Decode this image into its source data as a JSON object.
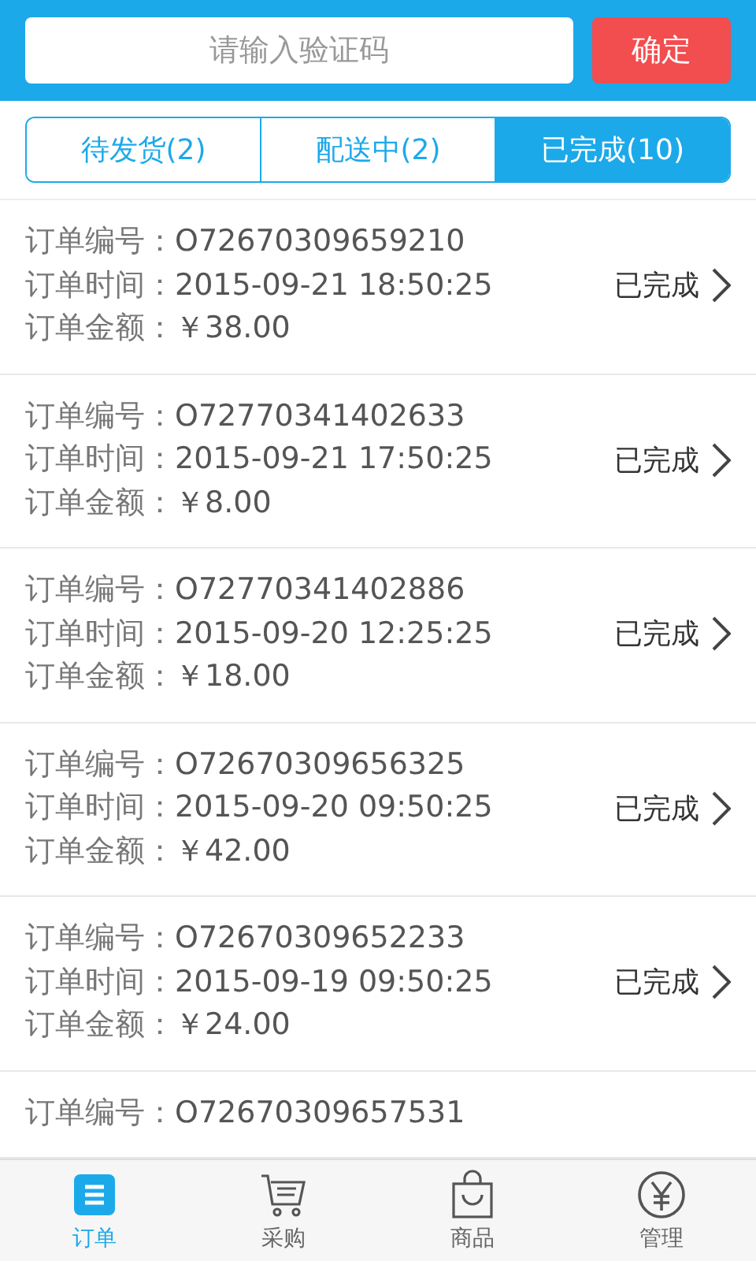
{
  "search": {
    "placeholder": "请输入验证码",
    "button": "确定"
  },
  "tabs": [
    {
      "label": "待发货(2)",
      "selected": false
    },
    {
      "label": "配送中(2)",
      "selected": false
    },
    {
      "label": "已完成(10)",
      "selected": true
    }
  ],
  "orders": [
    {
      "lines": [
        {
          "label": "订单编号：",
          "value": "O72670309659210"
        },
        {
          "label": "订单时间：",
          "value": "2015-09-21 18:50:25"
        },
        {
          "label": "订单金额：",
          "value": "￥38.00"
        }
      ],
      "status": "已完成"
    },
    {
      "lines": [
        {
          "label": "订单编号：",
          "value": "O72770341402633"
        },
        {
          "label": "订单时间：",
          "value": "2015-09-21 17:50:25"
        },
        {
          "label": "订单金额：",
          "value": "￥8.00"
        }
      ],
      "status": "已完成"
    },
    {
      "lines": [
        {
          "label": "订单编号：",
          "value": "O72770341402886"
        },
        {
          "label": "订单时间：",
          "value": "2015-09-20 12:25:25"
        },
        {
          "label": "订单金额：",
          "value": "￥18.00"
        }
      ],
      "status": "已完成"
    },
    {
      "lines": [
        {
          "label": "订单编号：",
          "value": "O72670309656325"
        },
        {
          "label": "订单时间：",
          "value": "2015-09-20 09:50:25"
        },
        {
          "label": "订单金额：",
          "value": "￥42.00"
        }
      ],
      "status": "已完成"
    },
    {
      "lines": [
        {
          "label": "订单编号：",
          "value": "O72670309652233"
        },
        {
          "label": "订单时间：",
          "value": "2015-09-19 09:50:25"
        },
        {
          "label": "订单金额：",
          "value": "￥24.00"
        }
      ],
      "status": "已完成"
    },
    {
      "lines": [
        {
          "label": "订单编号：",
          "value": "O72670309657531"
        }
      ]
    }
  ],
  "nav": [
    {
      "kind": "orders",
      "label": "订单",
      "selected": true
    },
    {
      "kind": "cart",
      "label": "采购",
      "selected": false
    },
    {
      "kind": "bag",
      "label": "商品",
      "selected": false
    },
    {
      "kind": "yen",
      "label": "管理",
      "selected": false
    }
  ]
}
